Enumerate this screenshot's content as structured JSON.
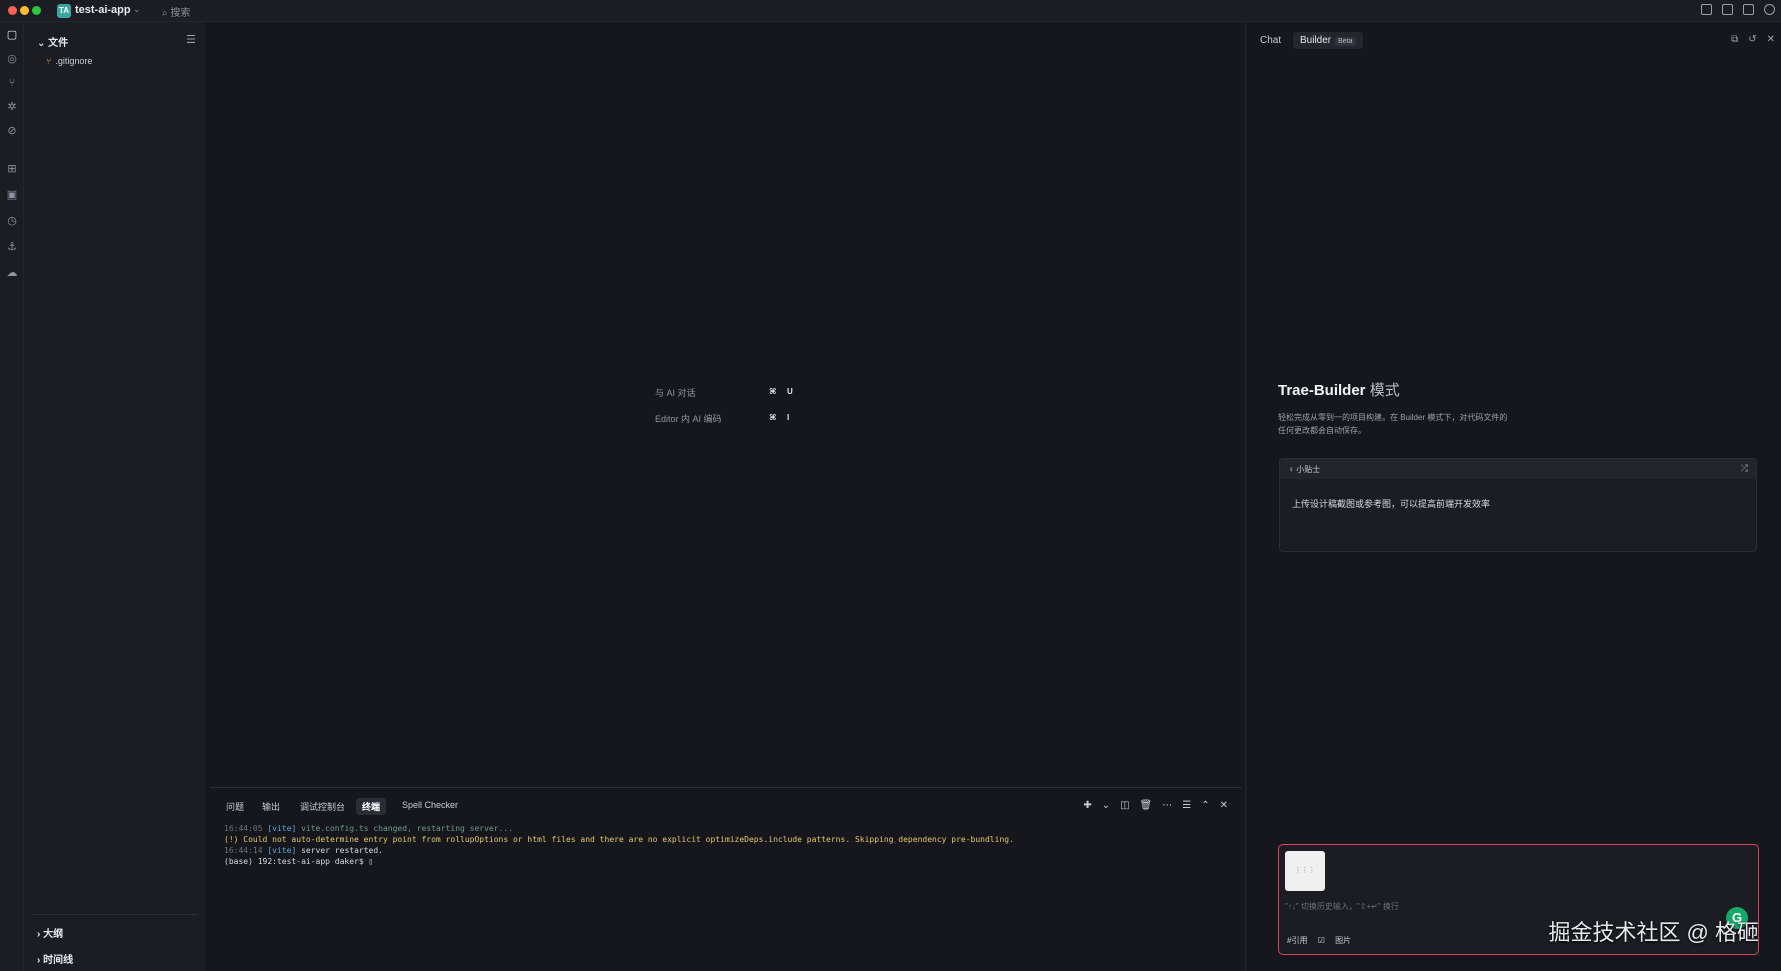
{
  "titlebar": {
    "app_badge": "TA",
    "app_name": "test-ai-app",
    "search_label": "搜索"
  },
  "sidebar": {
    "header": "文件",
    "files": [
      {
        "name": ".gitignore"
      }
    ],
    "sections": [
      "大纲",
      "时间线"
    ]
  },
  "editor": {
    "hints": [
      {
        "label": "与 AI 对话",
        "key1": "⌘",
        "key2": "U"
      },
      {
        "label": "Editor 内 AI 编码",
        "key1": "⌘",
        "key2": "I"
      }
    ]
  },
  "panel": {
    "tabs": [
      "问题",
      "输出",
      "调试控制台",
      "终端",
      "Spell Checker"
    ],
    "active_tab": "终端",
    "terminal": {
      "line1_time": "16:44:05",
      "line1_vite": "[vite]",
      "line1_msg": "vite.config.ts changed, restarting server...",
      "line2": "(!) Could not auto-determine entry point from rollupOptions or html files and there are no explicit optimizeDeps.include patterns. Skipping dependency pre-bundling.",
      "line3_time": "16:44:14",
      "line3_vite": "[vite]",
      "line3_msg": "server restarted.",
      "prompt": "(base) 192:test-ai-app daker$"
    }
  },
  "right_panel": {
    "tabs": {
      "chat": "Chat",
      "builder": "Builder",
      "beta": "Beta"
    },
    "title": "Trae-Builder",
    "title_mode": "模式",
    "description": "轻松完成从零到一的项目构建。在 Builder 模式下，对代码文件的任何更改都会自动保存。",
    "tips": {
      "header": "小贴士",
      "body": "上传设计稿截图或参考图，可以提高前端开发效率"
    },
    "input": {
      "placeholder": "\"↑↓\" 切换历史输入，\"⇧+↵\" 换行",
      "reference": "#引用",
      "image": "图片"
    }
  },
  "watermark": "掘金技术社区 @ 格砸",
  "colors": {
    "accent_red": "#d9455f",
    "grammarly": "#15a86b",
    "file_git": "#c9a04a"
  }
}
